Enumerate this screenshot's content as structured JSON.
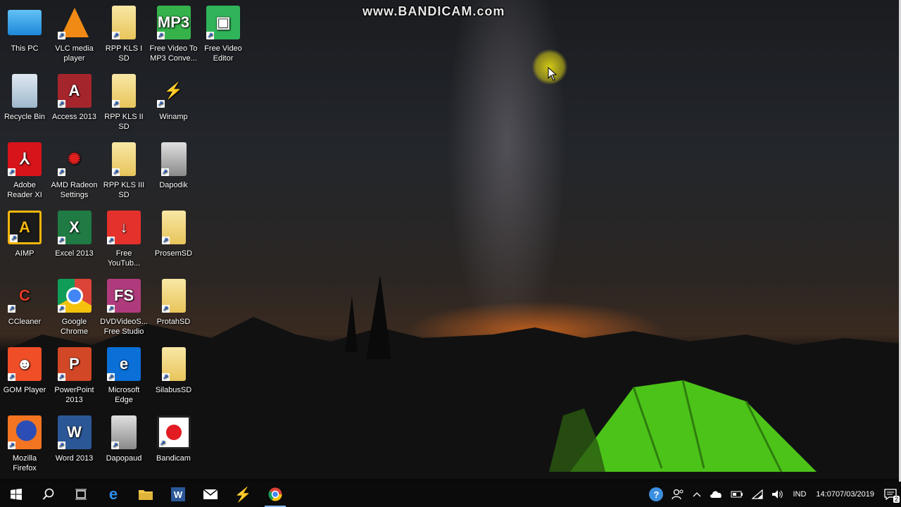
{
  "watermark": "www.BANDICAM.com",
  "desktop_icons": [
    {
      "label": "This PC",
      "icon": "this-pc-icon"
    },
    {
      "label": "VLC media player",
      "icon": "vlc-icon"
    },
    {
      "label": "RPP KLS I SD",
      "icon": "folder-icon"
    },
    {
      "label": "Free Video To MP3 Conve...",
      "icon": "mp3-converter-icon"
    },
    {
      "label": "Free Video Editor",
      "icon": "video-editor-icon"
    },
    {
      "label": "Recycle Bin",
      "icon": "recycle-bin-icon"
    },
    {
      "label": "Access 2013",
      "icon": "access-icon"
    },
    {
      "label": "RPP KLS II SD",
      "icon": "folder-icon"
    },
    {
      "label": "Winamp",
      "icon": "winamp-icon"
    },
    {
      "label": "Adobe Reader XI",
      "icon": "adobe-reader-icon"
    },
    {
      "label": "AMD Radeon Settings",
      "icon": "amd-radeon-icon"
    },
    {
      "label": "RPP KLS III SD",
      "icon": "folder-icon"
    },
    {
      "label": "Dapodik",
      "icon": "database-icon"
    },
    {
      "label": "AIMP",
      "icon": "aimp-icon"
    },
    {
      "label": "Excel 2013",
      "icon": "excel-icon"
    },
    {
      "label": "Free YouTub...",
      "icon": "youtube-downloader-icon"
    },
    {
      "label": "ProsemSD",
      "icon": "folder-icon"
    },
    {
      "label": "CCleaner",
      "icon": "ccleaner-icon"
    },
    {
      "label": "Google Chrome",
      "icon": "chrome-icon"
    },
    {
      "label": "DVDVideoS... Free Studio",
      "icon": "free-studio-icon"
    },
    {
      "label": "ProtahSD",
      "icon": "folder-icon"
    },
    {
      "label": "GOM Player",
      "icon": "gom-player-icon"
    },
    {
      "label": "PowerPoint 2013",
      "icon": "powerpoint-icon"
    },
    {
      "label": "Microsoft Edge",
      "icon": "edge-icon"
    },
    {
      "label": "SilabusSD",
      "icon": "folder-icon"
    },
    {
      "label": "Mozilla Firefox",
      "icon": "firefox-icon"
    },
    {
      "label": "Word 2013",
      "icon": "word-icon"
    },
    {
      "label": "Dapopaud",
      "icon": "database-icon"
    },
    {
      "label": "Bandicam",
      "icon": "bandicam-icon"
    }
  ],
  "taskbar": {
    "start_icon": "windows-logo-icon",
    "search_icon": "search-icon",
    "task_view_icon": "task-view-icon",
    "pinned": [
      "edge-icon",
      "file-explorer-icon",
      "word-icon",
      "mail-icon",
      "winamp-icon",
      "chrome-icon"
    ],
    "active_pinned": "chrome-icon",
    "tray": {
      "language": "IND",
      "time": "14:07",
      "date": "07/03/2019",
      "notification_count": "2"
    }
  },
  "colors": {
    "taskbar_bg": "#0b0b0b",
    "cursor_highlight": "#dcd214"
  }
}
